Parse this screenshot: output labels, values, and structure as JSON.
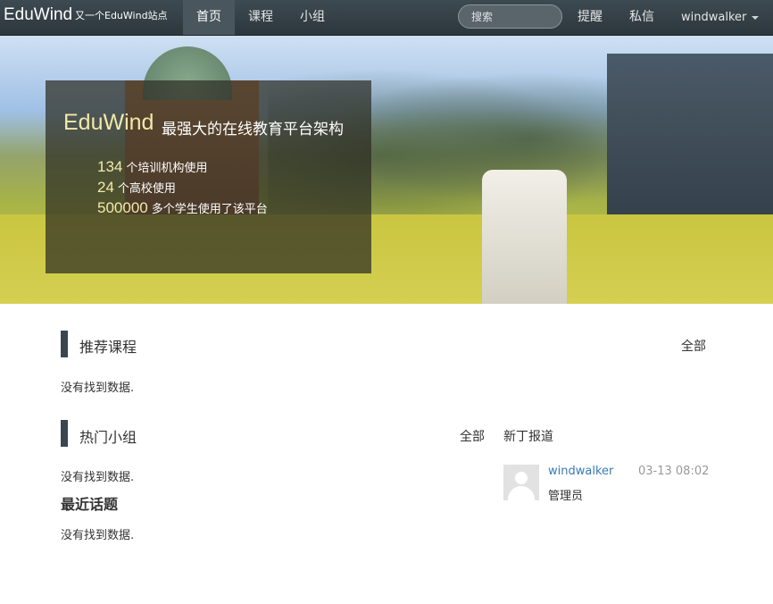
{
  "navbar": {
    "brand": "EduWind",
    "brand_sub": "又一个EduWind站点",
    "home": "首页",
    "courses": "课程",
    "groups": "小组",
    "search_placeholder": "搜索",
    "remind": "提醒",
    "messages": "私信",
    "user": "windwalker"
  },
  "hero": {
    "title": "EduWind",
    "tagline": "最强大的在线教育平台架构",
    "stats": [
      {
        "num": "134",
        "text": "个培训机构使用"
      },
      {
        "num": "24",
        "text": "个高校使用"
      },
      {
        "num": "500000",
        "text": "多个学生使用了该平台"
      }
    ]
  },
  "recommended": {
    "title": "推荐课程",
    "all": "全部",
    "empty": "没有找到数据."
  },
  "hot_groups": {
    "title": "热门小组",
    "all": "全部",
    "newcomers": "新丁报道",
    "empty": "没有找到数据."
  },
  "recent_topics": {
    "title": "最近话题",
    "empty": "没有找到数据."
  },
  "member": {
    "name": "windwalker",
    "time": "03-13 08:02",
    "role": "管理员"
  },
  "colors": {
    "navbar": "#2c363d",
    "accent_link": "#3a7ab5",
    "section_bar": "#3b4650"
  }
}
